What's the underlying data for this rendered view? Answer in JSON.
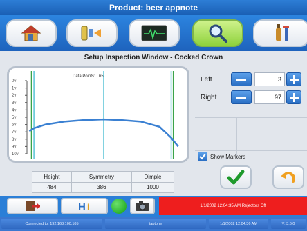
{
  "window": {
    "title": "Product: beer appnote"
  },
  "nav": {
    "items": [
      {
        "icon": "home-icon"
      },
      {
        "icon": "conveyor-icon"
      },
      {
        "icon": "waveform-monitor-icon"
      },
      {
        "icon": "magnifier-icon",
        "active": true
      },
      {
        "icon": "bottle-tools-icon"
      }
    ]
  },
  "panel": {
    "title": "Setup Inspection Window - Cocked Crown",
    "chart": {
      "data_points_label": "Data Points:",
      "data_points_value": "65"
    },
    "measurements": {
      "headers": [
        "Height",
        "Symmetry",
        "Dimple"
      ],
      "values": [
        "484",
        "386",
        "1000"
      ]
    },
    "controls": {
      "left": {
        "label": "Left",
        "value": "3"
      },
      "right": {
        "label": "Right",
        "value": "97"
      }
    },
    "show_markers": {
      "label": "Show Markers",
      "checked": true
    }
  },
  "bottom": {
    "alert": "1/1/2002 12:04:35 AM Rejectors Off"
  },
  "status": {
    "connection": "Connected to: 192.168.100.105",
    "user": "taptone",
    "datetime": "1/1/2002 12:04:36 AM",
    "version": "V: 3.6.0"
  },
  "colors": {
    "accent_blue": "#2b7fd7",
    "active_green": "#8fd23d",
    "alert_red": "#ee1e1e",
    "curve_blue": "#3a80d2",
    "marker_green": "#3aa34a",
    "marker_cyan": "#58c3d6"
  },
  "chart_data": {
    "type": "line",
    "title": "Data Points: 65",
    "y_tick_labels": [
      "0v",
      "1v",
      "2v",
      "3v",
      "4v",
      "5v",
      "6v",
      "7v",
      "8v",
      "9v",
      "10v"
    ],
    "ylim": [
      0,
      10
    ],
    "x": [
      1,
      3,
      8,
      16,
      24,
      33,
      41,
      49,
      57,
      62,
      65
    ],
    "series": [
      {
        "values": [
          6.9,
          6.5,
          6.0,
          5.6,
          5.4,
          5.3,
          5.4,
          5.6,
          6.3,
          7.8,
          9.0
        ]
      }
    ],
    "markers": [
      {
        "color": "green",
        "x": 2
      },
      {
        "color": "cyan",
        "x": 3
      },
      {
        "color": "cyan",
        "x": 33
      },
      {
        "color": "cyan",
        "x": 62
      },
      {
        "color": "green",
        "x": 63
      }
    ],
    "xlim": [
      0,
      66
    ],
    "grid": false
  }
}
